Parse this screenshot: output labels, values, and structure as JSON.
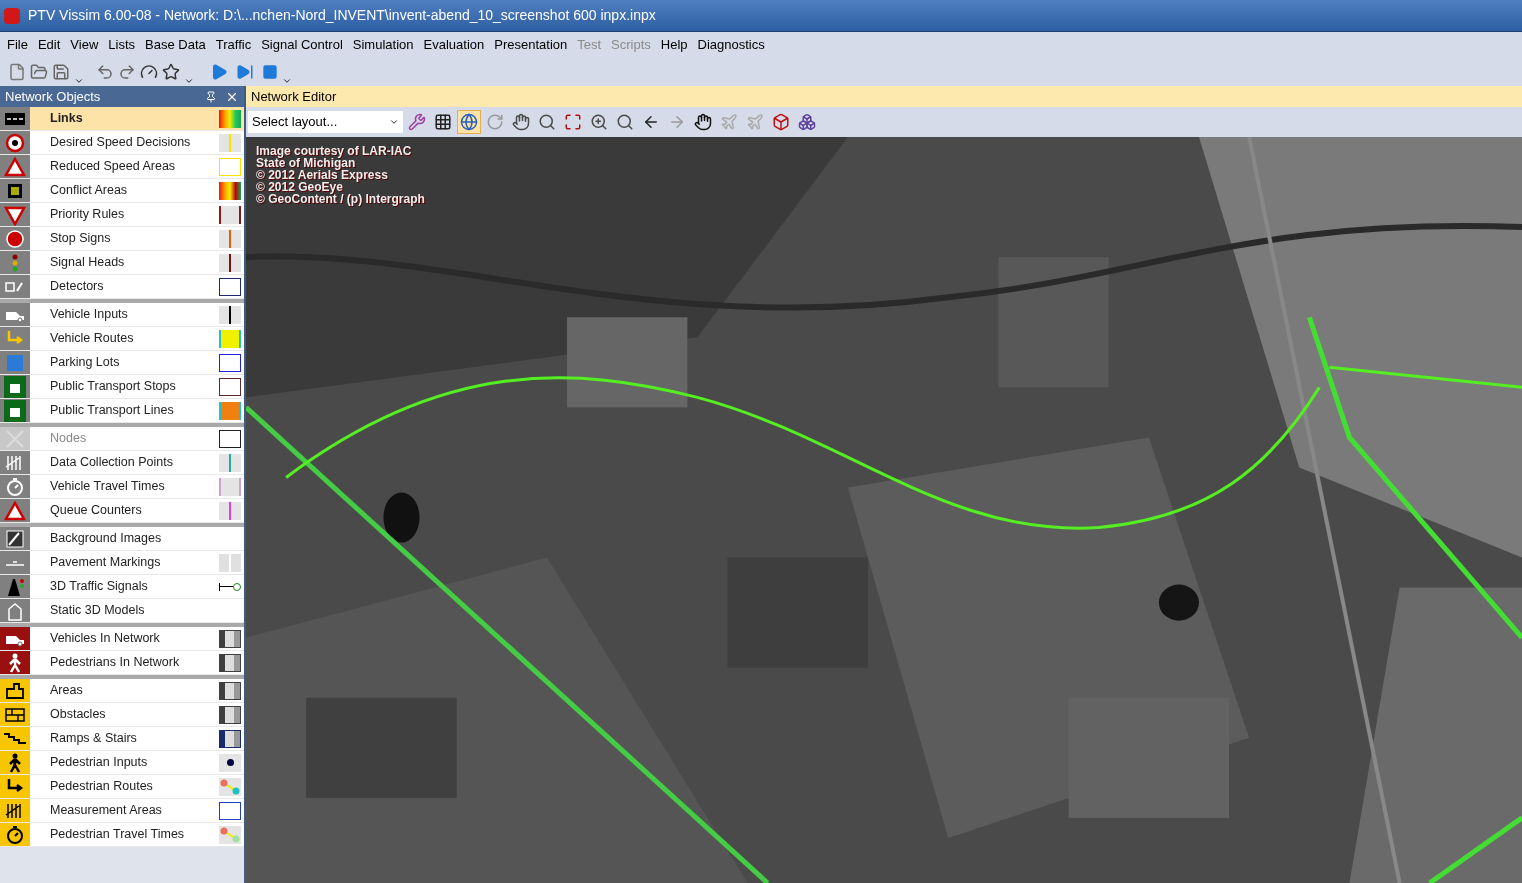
{
  "window": {
    "title": "PTV Vissim 6.00-08 - Network: D:\\...nchen-Nord_INVENT\\invent-abend_10_screenshot 600 inpx.inpx"
  },
  "menu": [
    {
      "label": "File",
      "disabled": false
    },
    {
      "label": "Edit",
      "disabled": false
    },
    {
      "label": "View",
      "disabled": false
    },
    {
      "label": "Lists",
      "disabled": false
    },
    {
      "label": "Base Data",
      "disabled": false
    },
    {
      "label": "Traffic",
      "disabled": false
    },
    {
      "label": "Signal Control",
      "disabled": false
    },
    {
      "label": "Simulation",
      "disabled": false
    },
    {
      "label": "Evaluation",
      "disabled": false
    },
    {
      "label": "Presentation",
      "disabled": false
    },
    {
      "label": "Test",
      "disabled": true
    },
    {
      "label": "Scripts",
      "disabled": true
    },
    {
      "label": "Help",
      "disabled": false
    },
    {
      "label": "Diagnostics",
      "disabled": false
    }
  ],
  "network_objects": {
    "title": "Network Objects",
    "groups": [
      {
        "items": [
          {
            "label": "Links",
            "selected": true,
            "disabled": false
          },
          {
            "label": "Desired Speed Decisions",
            "selected": false,
            "disabled": false
          },
          {
            "label": "Reduced Speed Areas",
            "selected": false,
            "disabled": false
          },
          {
            "label": "Conflict Areas",
            "selected": false,
            "disabled": false
          },
          {
            "label": "Priority Rules",
            "selected": false,
            "disabled": false
          },
          {
            "label": "Stop Signs",
            "selected": false,
            "disabled": false
          },
          {
            "label": "Signal Heads",
            "selected": false,
            "disabled": false
          },
          {
            "label": "Detectors",
            "selected": false,
            "disabled": false
          }
        ]
      },
      {
        "items": [
          {
            "label": "Vehicle Inputs",
            "selected": false,
            "disabled": false
          },
          {
            "label": "Vehicle Routes",
            "selected": false,
            "disabled": false
          },
          {
            "label": "Parking Lots",
            "selected": false,
            "disabled": false
          },
          {
            "label": "Public Transport Stops",
            "selected": false,
            "disabled": false
          },
          {
            "label": "Public Transport Lines",
            "selected": false,
            "disabled": false
          }
        ]
      },
      {
        "items": [
          {
            "label": "Nodes",
            "selected": false,
            "disabled": true
          },
          {
            "label": "Data Collection Points",
            "selected": false,
            "disabled": false
          },
          {
            "label": "Vehicle Travel Times",
            "selected": false,
            "disabled": false
          },
          {
            "label": "Queue Counters",
            "selected": false,
            "disabled": false
          }
        ]
      },
      {
        "items": [
          {
            "label": "Background Images",
            "selected": false,
            "disabled": false
          },
          {
            "label": "Pavement Markings",
            "selected": false,
            "disabled": false
          },
          {
            "label": "3D Traffic Signals",
            "selected": false,
            "disabled": false
          },
          {
            "label": "Static 3D Models",
            "selected": false,
            "disabled": false
          }
        ]
      },
      {
        "items": [
          {
            "label": "Vehicles In Network",
            "selected": false,
            "disabled": false
          },
          {
            "label": "Pedestrians In Network",
            "selected": false,
            "disabled": false
          }
        ]
      },
      {
        "items": [
          {
            "label": "Areas",
            "selected": false,
            "disabled": false
          },
          {
            "label": "Obstacles",
            "selected": false,
            "disabled": false
          },
          {
            "label": "Ramps & Stairs",
            "selected": false,
            "disabled": false
          },
          {
            "label": "Pedestrian Inputs",
            "selected": false,
            "disabled": false
          },
          {
            "label": "Pedestrian Routes",
            "selected": false,
            "disabled": false
          },
          {
            "label": "Measurement Areas",
            "selected": false,
            "disabled": false
          },
          {
            "label": "Pedestrian Travel Times",
            "selected": false,
            "disabled": false
          }
        ]
      }
    ]
  },
  "editor": {
    "title": "Network Editor",
    "layout_select": {
      "value": "Select layout..."
    },
    "attribution": [
      "Image courtesy of LAR-IAC",
      "State of Michigan",
      "© 2012 Aerials Express",
      "© 2012 GeoEye",
      "© GeoContent / (p) Intergraph"
    ]
  }
}
